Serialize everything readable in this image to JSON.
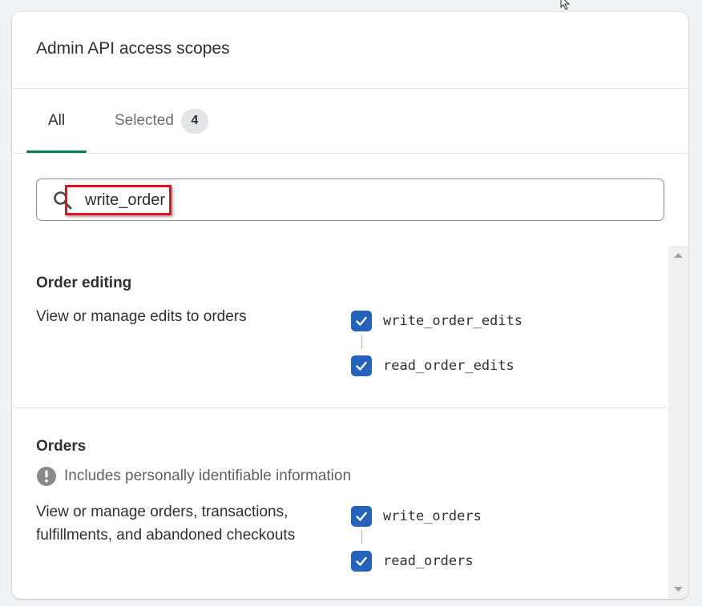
{
  "card": {
    "title": "Admin API access scopes"
  },
  "tabs": [
    {
      "label": "All",
      "active": true
    },
    {
      "label": "Selected",
      "badge": "4",
      "active": false
    }
  ],
  "search": {
    "value": "write_order",
    "placeholder": ""
  },
  "sections": [
    {
      "title": "Order editing",
      "description": "View or manage edits to orders",
      "scopes": [
        {
          "label": "write_order_edits",
          "checked": true
        },
        {
          "label": "read_order_edits",
          "checked": true
        }
      ]
    },
    {
      "title": "Orders",
      "notice": "Includes personally identifiable information",
      "description": "View or manage orders, transactions, fulfillments, and abandoned checkouts",
      "scopes": [
        {
          "label": "write_orders",
          "checked": true
        },
        {
          "label": "read_orders",
          "checked": true
        }
      ]
    }
  ],
  "colors": {
    "checkbox": "#2463bc",
    "active_tab_underline": "#007f5f",
    "highlight_box": "#e8101c",
    "badge_bg": "#e4e5e7"
  },
  "icons": {
    "search": "search-icon",
    "info": "info-icon",
    "check": "checkmark-icon",
    "cursor": "cursor-icon"
  }
}
